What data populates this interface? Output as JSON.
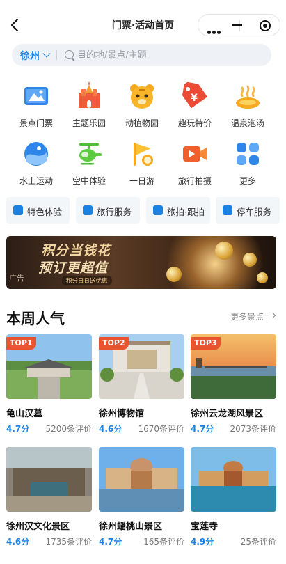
{
  "nav": {
    "title": "门票·活动首页"
  },
  "search": {
    "city": "徐州",
    "placeholder": "目的地/景点/主题"
  },
  "categories": [
    {
      "label": "景点门票",
      "icon": "ticket-icon"
    },
    {
      "label": "主题乐园",
      "icon": "castle-icon"
    },
    {
      "label": "动植物园",
      "icon": "tiger-icon"
    },
    {
      "label": "趣玩特价",
      "icon": "price-tag-icon"
    },
    {
      "label": "温泉泡汤",
      "icon": "hot-spring-icon"
    },
    {
      "label": "水上运动",
      "icon": "wave-icon"
    },
    {
      "label": "空中体验",
      "icon": "helicopter-icon"
    },
    {
      "label": "一日游",
      "icon": "flag-icon"
    },
    {
      "label": "旅行拍摄",
      "icon": "video-camera-icon"
    },
    {
      "label": "更多",
      "icon": "grid-icon"
    }
  ],
  "tags": [
    {
      "label": "特色体验"
    },
    {
      "label": "旅行服务"
    },
    {
      "label": "旅拍·跟拍"
    },
    {
      "label": "停车服务"
    }
  ],
  "banner": {
    "line1": "积分当钱花",
    "line2": "预订更超值",
    "line3": "积分日日送优惠",
    "ad": "广告"
  },
  "section": {
    "title": "本周人气",
    "more": "更多景点"
  },
  "attractions": [
    {
      "rank": "TOP1",
      "name": "龟山汉墓",
      "score": "4.7分",
      "reviews": "5200条评价"
    },
    {
      "rank": "TOP2",
      "name": "徐州博物馆",
      "score": "4.6分",
      "reviews": "1670条评价"
    },
    {
      "rank": "TOP3",
      "name": "徐州云龙湖风景区",
      "score": "4.7分",
      "reviews": "2073条评价"
    },
    {
      "rank": "",
      "name": "徐州汉文化景区",
      "score": "4.6分",
      "reviews": "1735条评价"
    },
    {
      "rank": "",
      "name": "徐州蟠桃山景区",
      "score": "4.7分",
      "reviews": "165条评价"
    },
    {
      "rank": "",
      "name": "宝莲寺",
      "score": "4.9分",
      "reviews": "25条评价"
    }
  ],
  "colors": {
    "accent": "#1a82e2",
    "rank": "#e8542f"
  }
}
